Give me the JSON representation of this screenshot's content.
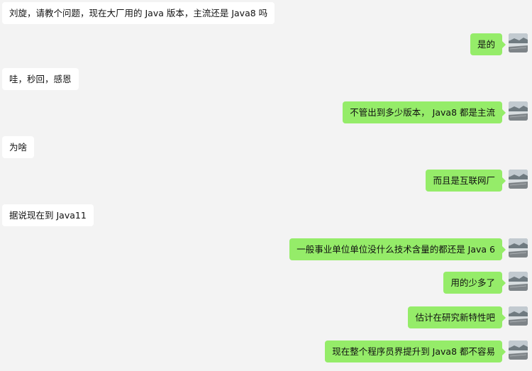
{
  "chat": {
    "messages": [
      {
        "side": "left",
        "text": "刘旋，请教个问题，现在大厂用的 Java 版本，主流还是 Java8 吗"
      },
      {
        "side": "right",
        "text": "是的"
      },
      {
        "side": "left",
        "text": "哇，秒回，感恩"
      },
      {
        "side": "right",
        "text": "不管出到多少版本， Java8 都是主流"
      },
      {
        "side": "left",
        "text": "为啥"
      },
      {
        "side": "right",
        "text": "而且是互联网厂"
      },
      {
        "side": "left",
        "text": "据说现在到 Java11"
      },
      {
        "side": "right",
        "text": "一般事业单位单位没什么技术含量的都还是 Java 6"
      },
      {
        "side": "right",
        "text": "用的少多了"
      },
      {
        "side": "right",
        "text": "估计在研究新特性吧"
      },
      {
        "side": "right",
        "text": "现在整个程序员界提升到 Java8 都不容易"
      }
    ],
    "avatar_icon": "landscape-avatar-icon",
    "colors": {
      "background": "#f3f3f3",
      "incoming_bubble": "#ffffff",
      "outgoing_bubble": "#95ec69"
    }
  }
}
